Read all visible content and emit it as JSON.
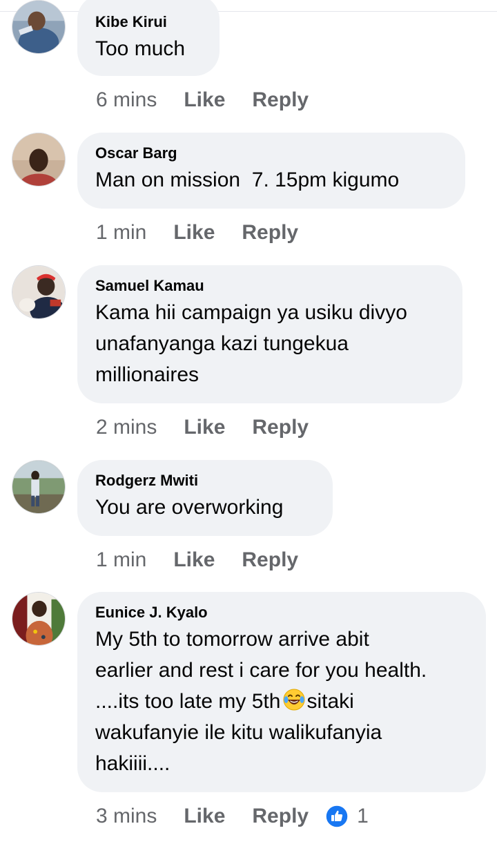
{
  "comments": [
    {
      "author": "Kibe Kirui",
      "lines": [
        "Too much"
      ],
      "time": "6 mins",
      "like_label": "Like",
      "reply_label": "Reply"
    },
    {
      "author": "Oscar Barg",
      "lines": [
        "Man on mission  7. 15pm kigumo"
      ],
      "time": "1 min",
      "like_label": "Like",
      "reply_label": "Reply"
    },
    {
      "author": "Samuel Kamau",
      "lines": [
        "Kama hii campaign ya usiku divyo",
        "unafanyanga kazi tungekua",
        "millionaires"
      ],
      "time": "2 mins",
      "like_label": "Like",
      "reply_label": "Reply"
    },
    {
      "author": "Rodgerz Mwiti",
      "lines": [
        "You are overworking"
      ],
      "time": "1 min",
      "like_label": "Like",
      "reply_label": "Reply"
    },
    {
      "author": "Eunice J. Kyalo",
      "lines": [
        "My 5th to tomorrow arrive abit",
        "earlier and rest i care for you health.",
        "....its too late my 5th",
        "sitaki",
        "wakufanyie ile kitu walikufanyia",
        "hakiiii...."
      ],
      "time": "3 mins",
      "like_label": "Like",
      "reply_label": "Reply",
      "reaction_icon": "like-reaction-icon",
      "reaction_count": "1"
    }
  ],
  "colors": {
    "bubble": "#f0f2f5",
    "meta_text": "#65676b",
    "like_blue": "#1877f2"
  }
}
